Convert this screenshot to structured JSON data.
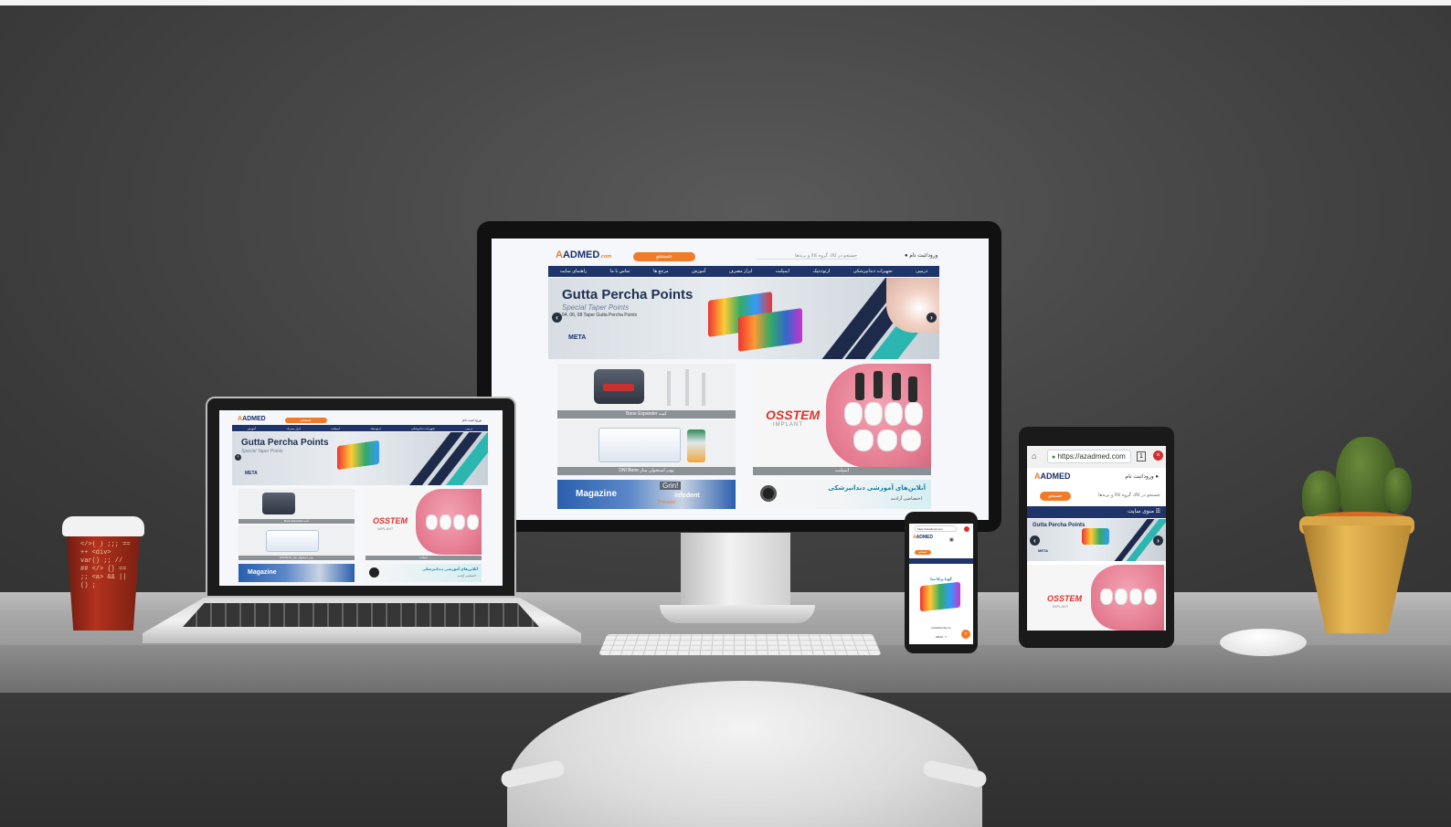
{
  "site": {
    "logo_main": "ADMED",
    "logo_a": "A",
    "logo_dot": ".com",
    "search_btn": "جستجو",
    "search_placeholder": "جستجو در کالا، گروه کالا و برندها",
    "login": "ورود/ثبت نام",
    "nav": [
      "درمپی",
      "تجهیزات دندانپزشکی",
      "ارتودنتیک",
      "ایمپلنت",
      "ابزار مصرف",
      "آموزش",
      "مرجع ها",
      "تماس با ما",
      "راهنمای سایت"
    ],
    "banner_title": "Gutta Percha Points",
    "banner_sub": "Special Taper Points",
    "banner_line": "04, 06, 08 Taper Gutta Percha Points",
    "banner_brand": "META",
    "card1_caption": "Bone Expander کیت",
    "card2_caption": "DNI Bone پودر استخوان ساز",
    "card3_caption": "ایمپلنت",
    "osstem": "OSSTEM",
    "implant": "IMPLANT",
    "magazine": "Magazine",
    "grin": "Grin!",
    "infodent": "infodent",
    "pinnacle": "Pinnacle",
    "course_title": "آنلاین‌های آموزشی دندانپزشکی",
    "course_sub": "اختصاصی آزادمد"
  },
  "browser": {
    "url": "https://azadmed.com",
    "menu_label": "منوی سایت"
  },
  "phone": {
    "url": "https://azadmed.com",
    "product_title": "گوتا پرکا متا",
    "product_name": "GuttaPercha Co",
    "product_price": "META ۰۴"
  },
  "colors": {
    "accent": "#f07b2a",
    "nav": "#1f3468",
    "brand_red": "#e0332c"
  }
}
